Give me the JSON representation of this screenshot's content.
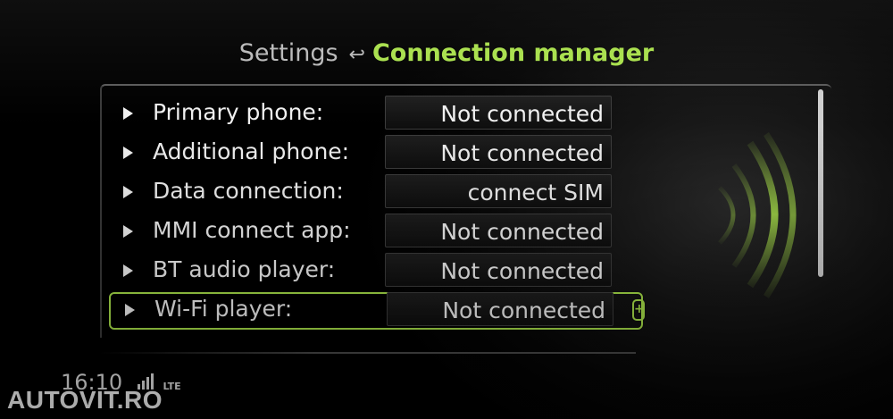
{
  "header": {
    "parent": "Settings",
    "back_icon": "↩",
    "current": "Connection manager"
  },
  "rows": [
    {
      "label": "Primary phone:",
      "value": "Not connected"
    },
    {
      "label": "Additional phone:",
      "value": "Not connected"
    },
    {
      "label": "Data connection:",
      "value": "connect SIM"
    },
    {
      "label": "MMI connect app:",
      "value": "Not connected"
    },
    {
      "label": "BT audio player:",
      "value": "Not connected"
    },
    {
      "label": "Wi-Fi player:",
      "value": "Not connected",
      "selected": true,
      "badge": "+"
    }
  ],
  "status_bar": {
    "time": "16:10",
    "network": "LTE",
    "signal_icon": "signal-bars-icon"
  },
  "watermark": "AUTOVIT.RO",
  "colors": {
    "accent": "#a8e04a",
    "text": "#f0f0f0",
    "muted": "#b9b9b9"
  }
}
